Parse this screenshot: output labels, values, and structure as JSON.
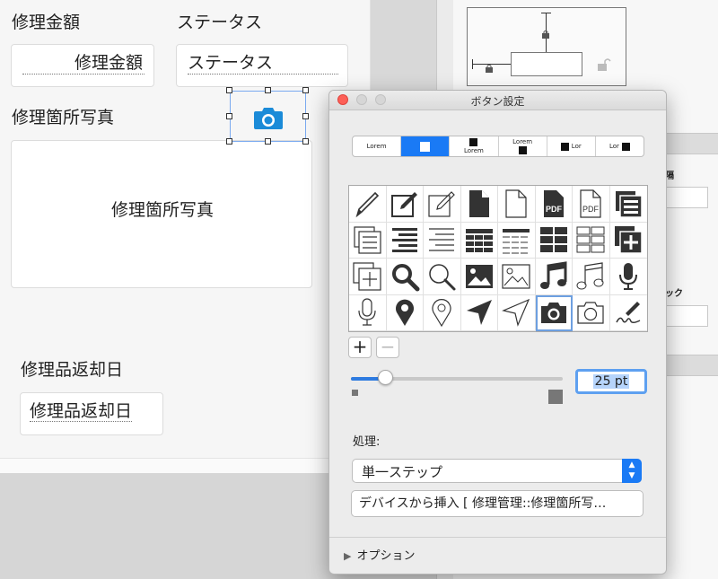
{
  "layout": {
    "fields": [
      {
        "label": "修理金額",
        "value": "修理金額"
      },
      {
        "label": "ステータス",
        "value": "ステータス"
      },
      {
        "label": "修理箇所写真",
        "value": "修理箇所写真"
      },
      {
        "label": "修理品返却日",
        "value": "修理品返却日"
      }
    ],
    "camera_button": {
      "icon": "camera-icon",
      "color": "#1b8bd8"
    }
  },
  "inspector": {
    "label_1": "隔",
    "label_2": "ック"
  },
  "panel": {
    "title": "ボタン設定",
    "style_segments": [
      {
        "label": "Lorem",
        "selected": false
      },
      {
        "label": "",
        "selected": true
      },
      {
        "label": "Lorem",
        "selected": false
      },
      {
        "label": "Lorem",
        "selected": false
      },
      {
        "label": "Lor",
        "selected": false
      },
      {
        "label": "Lor",
        "selected": false
      }
    ],
    "icons": [
      "pencil-icon",
      "edit-solid-icon",
      "edit-outline-icon",
      "document-solid-icon",
      "document-outline-icon",
      "pdf-solid-icon",
      "pdf-outline-icon",
      "stack-solid-icon",
      "stack-outline-icon",
      "align-solid-icon",
      "align-outline-icon",
      "table-solid-icon",
      "table-outline-icon",
      "grid-solid-icon",
      "grid-outline-icon",
      "add-solid-icon",
      "add-outline-icon",
      "search-solid-icon",
      "search-outline-icon",
      "image-solid-icon",
      "image-outline-icon",
      "music-solid-icon",
      "music-outline-icon",
      "mic-solid-icon",
      "mic-outline-icon",
      "pin-solid-icon",
      "pin-outline-icon",
      "navigate-solid-icon",
      "navigate-outline-icon",
      "camera-solid-icon",
      "camera-outline-icon",
      "signature-icon"
    ],
    "selected_icon": 29,
    "pdf_text": "PDF",
    "add_label": "+",
    "remove_label": "−",
    "slider_fraction": 0.16,
    "size_value": "25 pt",
    "action_label": "処理:",
    "action_value": "単一ステップ",
    "step_text": "デバイスから挿入 [ 修理管理::修理箇所写…",
    "options_label": "オプション",
    "options_arrow": "▶"
  }
}
